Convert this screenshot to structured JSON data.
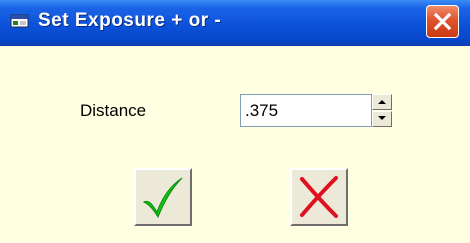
{
  "window": {
    "title": "Set Exposure + or -",
    "icons": {
      "app": "window-icon",
      "close": "close-icon"
    }
  },
  "form": {
    "distance_label": "Distance",
    "distance_value": ".375"
  },
  "buttons": {
    "ok_icon": "checkmark-icon",
    "cancel_icon": "cross-icon"
  },
  "colors": {
    "titlebar": "#0a50d8",
    "background": "#ffffe1",
    "close": "#e0532c",
    "check": "#17b817",
    "cross": "#e01020"
  }
}
